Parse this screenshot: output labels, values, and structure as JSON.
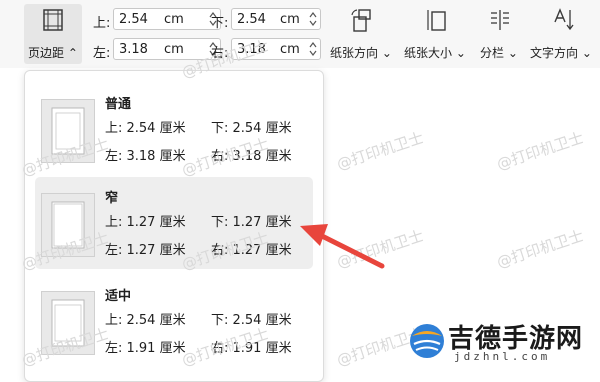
{
  "toolbar": {
    "margins_button": "页边距",
    "top_label": "上:",
    "top_value": "2.54",
    "bottom_label": "下:",
    "bottom_value": "2.54",
    "left_label": "左:",
    "left_value": "3.18",
    "right_label": "右:",
    "right_value": "3.18",
    "unit": "cm",
    "orientation_label": "纸张方向",
    "size_label": "纸张大小",
    "columns_label": "分栏",
    "text_direction_label": "文字方向"
  },
  "presets": [
    {
      "name": "普通",
      "top": "上: 2.54 厘米",
      "bottom": "下: 2.54 厘米",
      "left": "左: 3.18 厘米",
      "right": "右: 3.18 厘米",
      "selected": false
    },
    {
      "name": "窄",
      "top": "上: 1.27 厘米",
      "bottom": "下: 1.27 厘米",
      "left": "左: 1.27 厘米",
      "right": "右: 1.27 厘米",
      "selected": true
    },
    {
      "name": "适中",
      "top": "上: 2.54 厘米",
      "bottom": "下: 2.54 厘米",
      "left": "左: 1.91 厘米",
      "right": "右: 1.91 厘米",
      "selected": false
    }
  ],
  "watermark": "@打印机卫士",
  "logo": {
    "name": "吉德手游网",
    "domain": "jdzhnl.com"
  },
  "colors": {
    "arrow": "#e8453c",
    "selected_bg": "#eeeeee",
    "toolbar_bg": "#f7f7f7"
  }
}
